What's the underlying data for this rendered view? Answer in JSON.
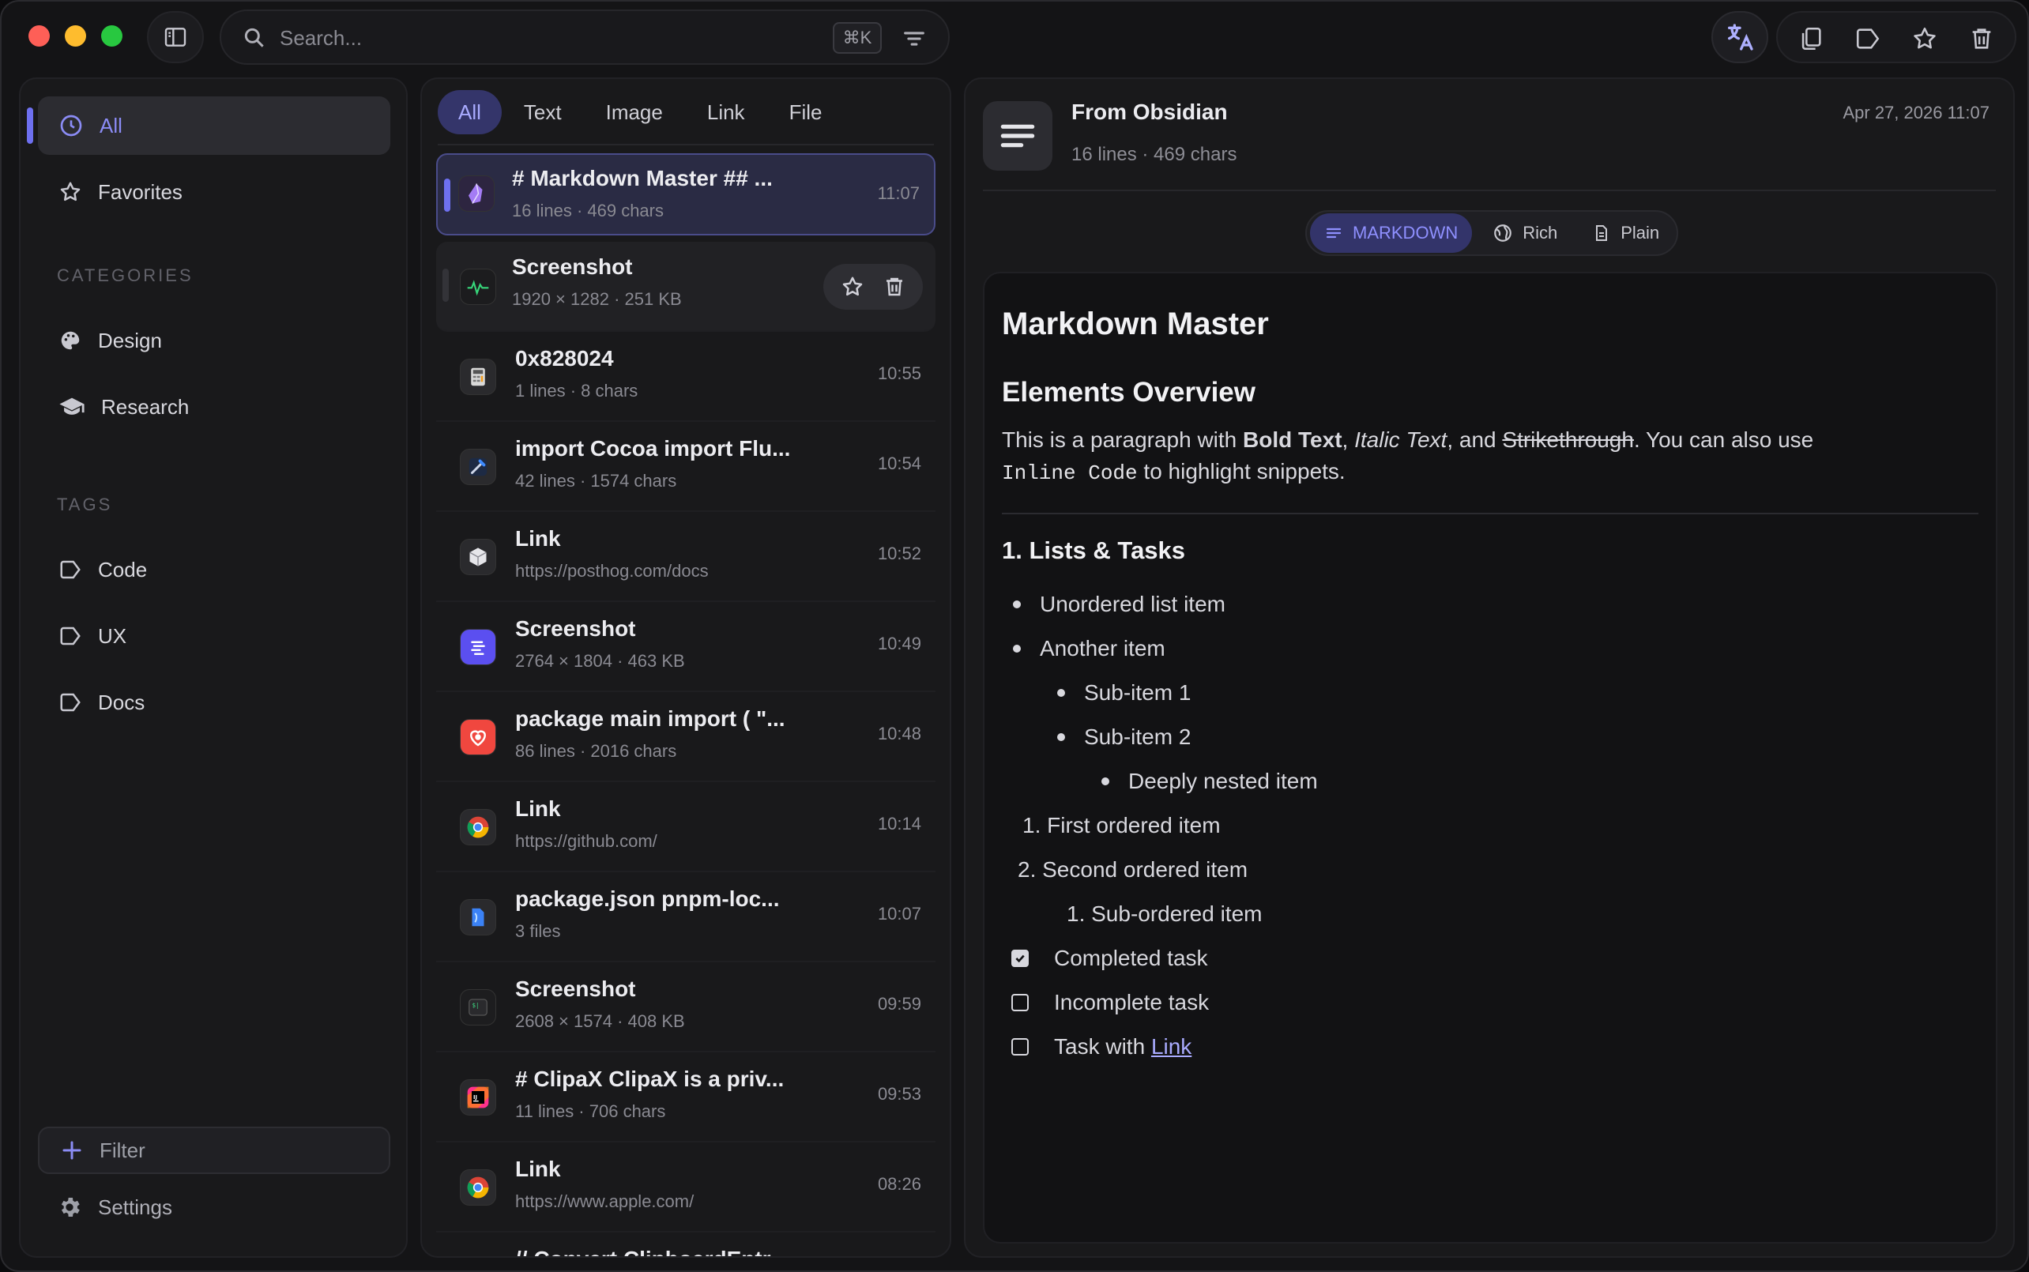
{
  "search": {
    "placeholder": "Search...",
    "shortcut": "⌘K"
  },
  "sidebar": {
    "items": [
      {
        "label": "All",
        "icon": "clock-icon",
        "active": true
      },
      {
        "label": "Favorites",
        "icon": "star-icon"
      }
    ],
    "categories_label": "CATEGORIES",
    "categories": [
      {
        "label": "Design",
        "icon": "palette-icon"
      },
      {
        "label": "Research",
        "icon": "graduation-cap-icon"
      }
    ],
    "tags_label": "TAGS",
    "tags": [
      {
        "label": "Code",
        "icon": "tag-icon"
      },
      {
        "label": "UX",
        "icon": "tag-icon"
      },
      {
        "label": "Docs",
        "icon": "tag-icon"
      }
    ],
    "filter_label": "Filter",
    "settings_label": "Settings"
  },
  "tabs": [
    "All",
    "Text",
    "Image",
    "Link",
    "File"
  ],
  "list": [
    {
      "title": "# Markdown Master ## ...",
      "sub": "16 lines · 469 chars",
      "time": "11:07",
      "icon": "obsidian-icon",
      "selected": true
    },
    {
      "title": "Screenshot",
      "sub": "1920 × 1282 · 251 KB",
      "time": "",
      "icon": "activity-monitor-icon",
      "hover": true
    },
    {
      "title": "0x828024",
      "sub": "1 lines · 8 chars",
      "time": "10:55",
      "icon": "calculator-icon"
    },
    {
      "title": "import Cocoa import Flu...",
      "sub": "42 lines · 1574 chars",
      "time": "10:54",
      "icon": "xcode-icon"
    },
    {
      "title": "Link",
      "sub": "https://posthog.com/docs",
      "time": "10:52",
      "icon": "box-icon"
    },
    {
      "title": "Screenshot",
      "sub": "2764 × 1804 · 463 KB",
      "time": "10:49",
      "icon": "app-purple-icon"
    },
    {
      "title": "package main import ( \"...",
      "sub": "86 lines · 2016 chars",
      "time": "10:48",
      "icon": "app-red-icon"
    },
    {
      "title": "Link",
      "sub": "https://github.com/",
      "time": "10:14",
      "icon": "chrome-icon"
    },
    {
      "title": "package.json pnpm-loc...",
      "sub": "3 files",
      "time": "10:07",
      "icon": "finder-icon"
    },
    {
      "title": "Screenshot",
      "sub": "2608 × 1574 · 408 KB",
      "time": "09:59",
      "icon": "terminal-icon"
    },
    {
      "title": "# ClipaX ClipaX is a priv...",
      "sub": "11 lines · 706 chars",
      "time": "09:53",
      "icon": "intellij-icon"
    },
    {
      "title": "Link",
      "sub": "https://www.apple.com/",
      "time": "08:26",
      "icon": "chrome-icon"
    },
    {
      "title": "// Convert ClipboardEntr...",
      "sub": "",
      "time": "",
      "icon": "code-icon"
    }
  ],
  "detail": {
    "title": "From Obsidian",
    "meta": "16 lines · 469 chars",
    "date": "Apr 27, 2026 11:07",
    "modes": [
      "MARKDOWN",
      "Rich",
      "Plain"
    ],
    "doc": {
      "h1": "Markdown Master",
      "h2": "Elements Overview",
      "p_1": "This is a paragraph with ",
      "p_bold": "Bold Text",
      "p_2": ", ",
      "p_italic": "Italic Text",
      "p_3": ", and ",
      "p_strike": "Strikethrough",
      "p_4": ". You can also use ",
      "p_code": "Inline Code",
      "p_5": " to highlight snippets.",
      "h3": "1. Lists & Tasks",
      "ul1": "Unordered list item",
      "ul2": "Another item",
      "sub1": "Sub-item 1",
      "sub2": "Sub-item 2",
      "deep": "Deeply nested item",
      "ol1": "1. First ordered item",
      "ol2": "2. Second ordered item",
      "ol_sub": "1. Sub-ordered item",
      "task1": "Completed task",
      "task2": "Incomplete task",
      "task3_pre": "Task with ",
      "task3_link": "Link"
    }
  },
  "colors": {
    "accent": "#6e70f0",
    "accent_text": "#8b8cf5"
  }
}
